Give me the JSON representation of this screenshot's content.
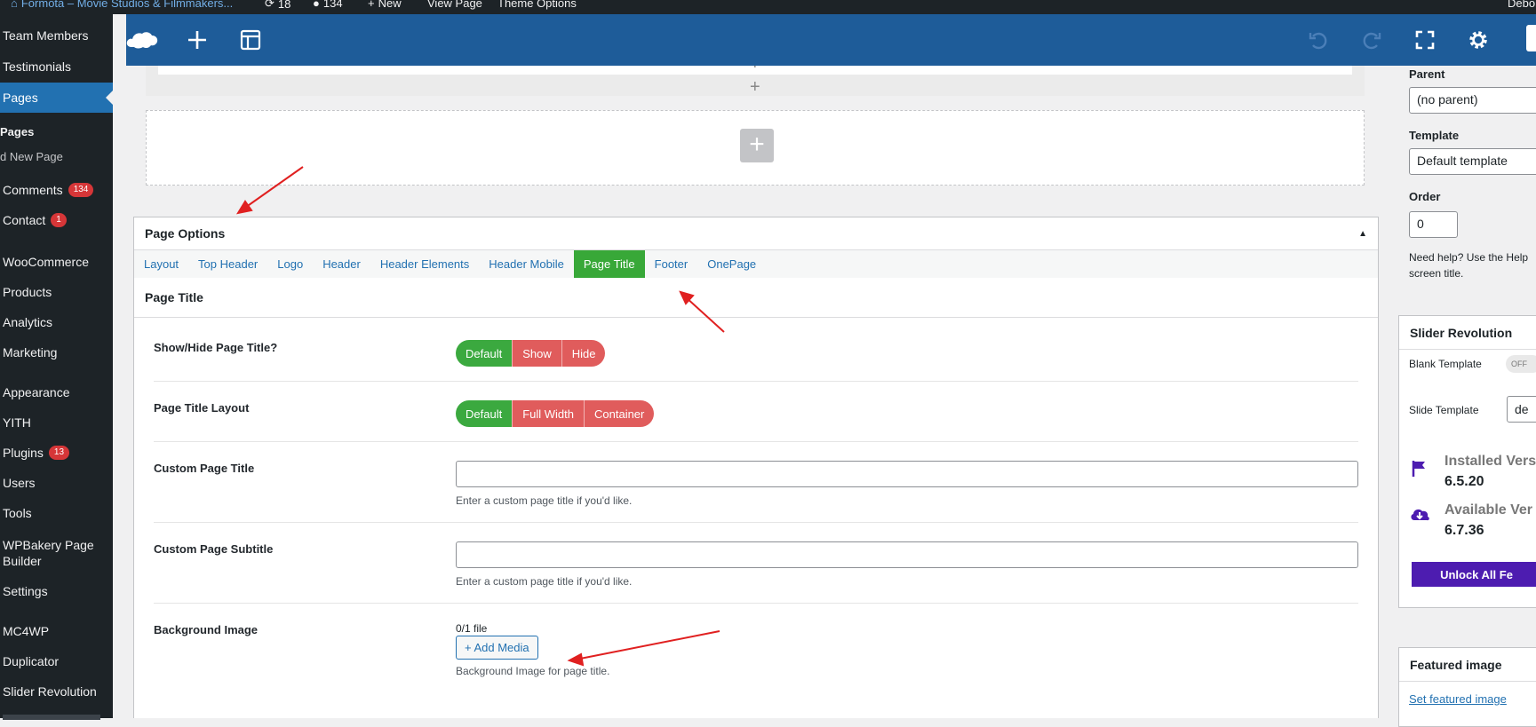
{
  "admin_bar": {
    "site_name": "Formota – Movie Studios & Filmmakers...",
    "updates_count": "18",
    "comments_count": "134",
    "new_label": "New",
    "view_page_label": "View Page",
    "theme_options_label": "Theme Options",
    "user_label": "Debo"
  },
  "sidebar": {
    "items": [
      {
        "label": "Team Members"
      },
      {
        "label": "Testimonials"
      },
      {
        "label": "Pages",
        "active": true
      },
      {
        "label": "Pages"
      },
      {
        "label": "d New Page"
      },
      {
        "label": "Comments",
        "badge": "134"
      },
      {
        "label": "Contact",
        "badge": "1"
      },
      {
        "label": "WooCommerce"
      },
      {
        "label": "Products"
      },
      {
        "label": "Analytics"
      },
      {
        "label": "Marketing"
      },
      {
        "label": "Appearance"
      },
      {
        "label": "YITH"
      },
      {
        "label": "Plugins",
        "badge": "13"
      },
      {
        "label": "Users"
      },
      {
        "label": "Tools"
      },
      {
        "label": "WPBakery Page Builder"
      },
      {
        "label": "Settings"
      },
      {
        "label": "MC4WP"
      },
      {
        "label": "Duplicator"
      },
      {
        "label": "Slider Revolution"
      }
    ]
  },
  "toolbar": {
    "icons": [
      "wpbakery-logo-icon",
      "add-element-icon",
      "templates-icon",
      "undo-icon",
      "redo-icon",
      "fullscreen-icon",
      "settings-icon"
    ]
  },
  "page_options": {
    "title": "Page Options",
    "tabs": [
      "Layout",
      "Top Header",
      "Logo",
      "Header",
      "Header Elements",
      "Header Mobile",
      "Page Title",
      "Footer",
      "OnePage"
    ],
    "active_tab": "Page Title",
    "section_title": "Page Title",
    "fields": {
      "show_hide": {
        "label": "Show/Hide Page Title?",
        "options": [
          "Default",
          "Show",
          "Hide"
        ],
        "selected": "Default"
      },
      "layout": {
        "label": "Page Title Layout",
        "options": [
          "Default",
          "Full Width",
          "Container"
        ],
        "selected": "Default"
      },
      "custom_title": {
        "label": "Custom Page Title",
        "value": "",
        "desc": "Enter a custom page title if you'd like."
      },
      "custom_subtitle": {
        "label": "Custom Page Subtitle",
        "value": "",
        "desc": "Enter a custom page title if you'd like."
      },
      "background_image": {
        "label": "Background Image",
        "count": "0/1 file",
        "button": "+ Add Media",
        "desc": "Background Image for page title."
      }
    }
  },
  "right_sidebar": {
    "parent_label": "Parent",
    "parent_value": "(no parent)",
    "template_label": "Template",
    "template_value": "Default template",
    "order_label": "Order",
    "order_value": "0",
    "help_text_1": "Need help? Use the Help",
    "help_text_2": "screen title.",
    "slider_revolution": {
      "title": "Slider Revolution",
      "blank_template_label": "Blank Template",
      "blank_template_toggle": "OFF",
      "slide_template_label": "Slide Template",
      "slide_template_value": "de",
      "installed_label": "Installed Vers",
      "installed_version": "6.5.20",
      "available_label": "Available Ver",
      "available_version": "6.7.36",
      "unlock_button": "Unlock All Fe"
    },
    "featured_image": {
      "title": "Featured image",
      "link": "Set featured image"
    }
  },
  "colors": {
    "admin_dark": "#1d2327",
    "wp_blue": "#2271b1",
    "builder_blue": "#1e5c99",
    "tab_active_green": "#38a838",
    "toggle_green": "#3ba93f",
    "toggle_red": "#e05c5c",
    "annotation_red": "#e02020",
    "revslider_purple": "#4d1cb0"
  }
}
